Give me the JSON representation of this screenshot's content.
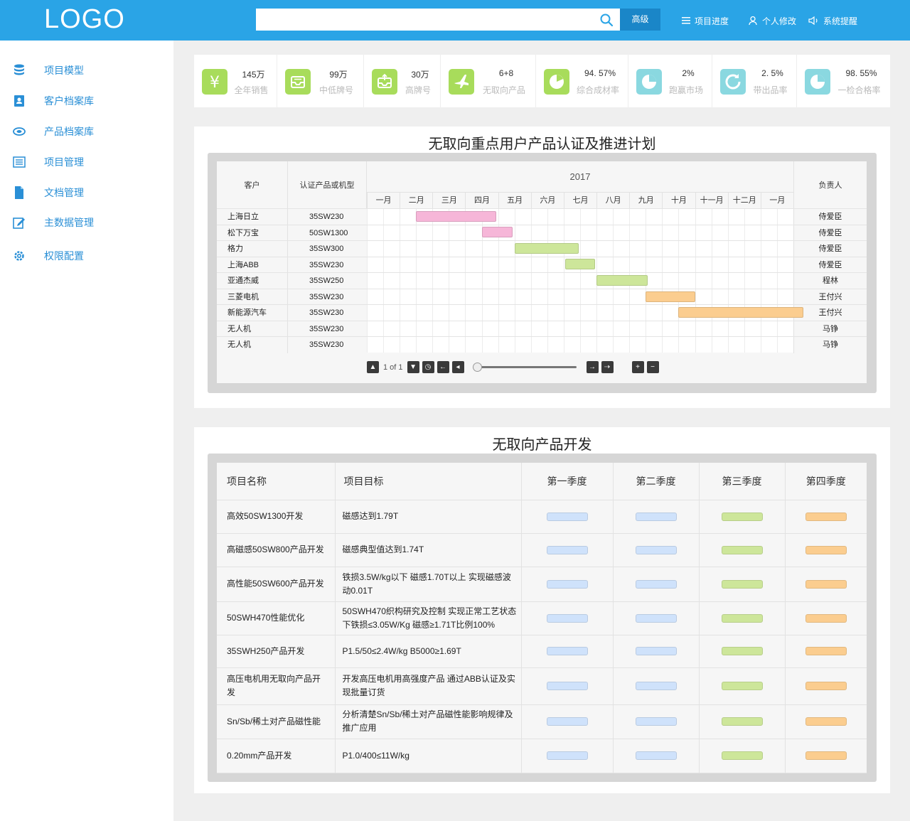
{
  "header": {
    "logo": "LOGO",
    "search_placeholder": "",
    "advanced_label": "高级",
    "nav": [
      {
        "label": "项目进度",
        "icon": "list-icon"
      },
      {
        "label": "个人修改",
        "icon": "user-icon"
      },
      {
        "label": "系统提醒",
        "icon": "speaker-icon"
      }
    ]
  },
  "sidebar": {
    "items": [
      {
        "label": "项目模型",
        "icon": "database-icon"
      },
      {
        "label": "客户档案库",
        "icon": "contact-book-icon"
      },
      {
        "label": "产品档案库",
        "icon": "product-icon"
      },
      {
        "label": "项目管理",
        "icon": "list-icon"
      },
      {
        "label": "文档管理",
        "icon": "document-icon"
      },
      {
        "label": "主数据管理",
        "icon": "edit-icon"
      },
      {
        "label": "权限配置",
        "icon": "gear-icon"
      }
    ]
  },
  "stats": [
    {
      "value": "145万",
      "label": "全年销售",
      "icon": "yen-icon",
      "color": "#a8dc5b"
    },
    {
      "value": "99万",
      "label": "中低牌号",
      "icon": "inbox-icon",
      "color": "#a8dc5b"
    },
    {
      "value": "30万",
      "label": "高牌号",
      "icon": "inbox-upload-icon",
      "color": "#a8dc5b"
    },
    {
      "value": "6+8",
      "label": "无取向产品",
      "icon": "airplane-icon",
      "color": "#a8dc5b"
    },
    {
      "value": "94. 57%",
      "label": "综合成材率",
      "icon": "clock-pie-icon",
      "color": "#a8dc5b"
    },
    {
      "value": "2%",
      "label": "跑赢市场",
      "icon": "pie-chart-icon",
      "color": "#8ad8e0"
    },
    {
      "value": "2. 5%",
      "label": "带出品率",
      "icon": "refresh-icon",
      "color": "#8ad8e0"
    },
    {
      "value": "98. 55%",
      "label": "一检合格率",
      "icon": "pie-chart-icon",
      "color": "#8ad8e0"
    }
  ],
  "gantt": {
    "title": "无取向重点用户产品认证及推进计划",
    "col_customer": "客户",
    "col_product": "认证产品或机型",
    "col_year": "2017",
    "col_owner": "负责人",
    "months": [
      "一月",
      "二月",
      "三月",
      "四月",
      "五月",
      "六月",
      "七月",
      "八月",
      "九月",
      "十月",
      "十一月",
      "十二月",
      "一月"
    ],
    "rows": [
      {
        "customer": "上海日立",
        "product": "35SW230",
        "owner": "侍爱臣",
        "start": 3.0,
        "end": 7.9,
        "color": "#f6b6d8"
      },
      {
        "customer": "松下万宝",
        "product": "50SW1300",
        "owner": "侍爱臣",
        "start": 7.0,
        "end": 8.9,
        "color": "#f6b6d8"
      },
      {
        "customer": "格力",
        "product": "35SW300",
        "owner": "侍爱臣",
        "start": 9.0,
        "end": 12.9,
        "color": "#cde69a"
      },
      {
        "customer": "上海ABB",
        "product": "35SW230",
        "owner": "侍爱臣",
        "start": 12.1,
        "end": 13.9,
        "color": "#cde69a"
      },
      {
        "customer": "亚通杰威",
        "product": "35SW250",
        "owner": "程林",
        "start": 14.0,
        "end": 17.1,
        "color": "#cde69a"
      },
      {
        "customer": "三菱电机",
        "product": "35SW230",
        "owner": "王付兴",
        "start": 17.0,
        "end": 20.0,
        "color": "#fbcd8f"
      },
      {
        "customer": "新能源汽车",
        "product": "35SW230",
        "owner": "王付兴",
        "start": 19.0,
        "end": 26.6,
        "color": "#fbcd8f"
      },
      {
        "customer": "无人机",
        "product": "35SW230",
        "owner": "马铮",
        "start": null,
        "end": null,
        "color": ""
      },
      {
        "customer": "无人机",
        "product": "35SW230",
        "owner": "马铮",
        "start": null,
        "end": null,
        "color": ""
      }
    ],
    "pager_text": "1 of 1"
  },
  "dev": {
    "title": "无取向产品开发",
    "headers": [
      "项目名称",
      "项目目标",
      "第一季度",
      "第二季度",
      "第三季度",
      "第四季度"
    ],
    "quarter_colors": [
      "#cfe2fb",
      "#cfe2fb",
      "#cde69a",
      "#fbcd8f"
    ],
    "rows": [
      {
        "name": "高效50SW1300开发",
        "goal": "磁感达到1.79T"
      },
      {
        "name": "高磁感50SW800产品开发",
        "goal": "磁感典型值达到1.74T"
      },
      {
        "name": "高性能50SW600产品开发",
        "goal": "铁损3.5W/kg以下  磁感1.70T以上   实现磁感波动0.01T"
      },
      {
        "name": "50SWH470性能优化",
        "goal": "50SWH470织构研究及控制  实现正常工艺状态下铁损≤3.05W/Kg    磁感≥1.71T比例100%"
      },
      {
        "name": "35SWH250产品开发",
        "goal": "P1.5/50≤2.4W/kg  B5000≥1.69T"
      },
      {
        "name": "高压电机用无取向产品开发",
        "goal": "开发高压电机用高强度产品    通过ABB认证及实现批量订货"
      },
      {
        "name": "Sn/Sb/稀土对产品磁性能",
        "goal": "分析清楚Sn/Sb/稀土对产品磁性能影响规律及推广应用"
      },
      {
        "name": "0.20mm产品开发",
        "goal": "P1.0/400≤11W/kg"
      }
    ]
  }
}
